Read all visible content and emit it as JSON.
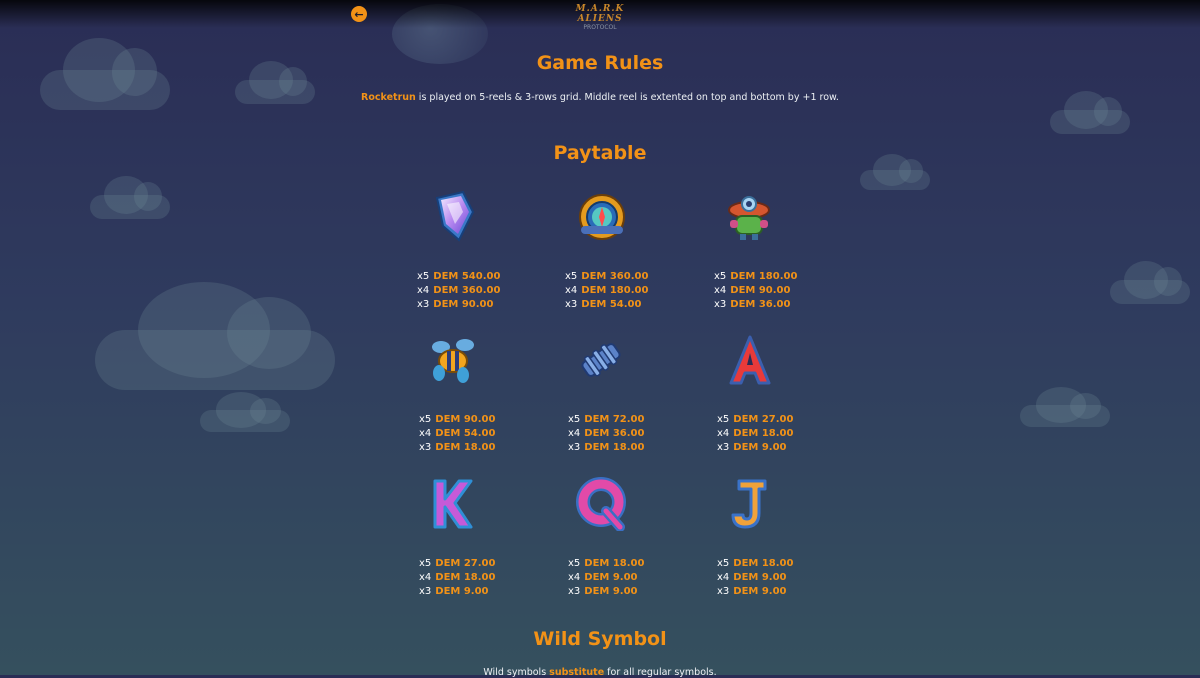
{
  "header": {
    "back_icon": "arrow-left-icon",
    "logo_title": "M.A.R.K ALIENS",
    "logo_sub": "PROTOCOL"
  },
  "rules": {
    "title": "Game Rules",
    "game_name": "Rocketrun",
    "description": " is played on 5-reels & 3-rows grid. Middle reel is extented on top and bottom by +1 row."
  },
  "paytable": {
    "title": "Paytable",
    "symbols": [
      {
        "icon": "crystal-gem-icon",
        "pays": [
          {
            "m": "x5",
            "v": "DEM 540.00"
          },
          {
            "m": "x4",
            "v": "DEM 360.00"
          },
          {
            "m": "x3",
            "v": "DEM 90.00"
          }
        ]
      },
      {
        "icon": "compass-icon",
        "pays": [
          {
            "m": "x5",
            "v": "DEM 360.00"
          },
          {
            "m": "x4",
            "v": "DEM 180.00"
          },
          {
            "m": "x3",
            "v": "DEM 54.00"
          }
        ]
      },
      {
        "icon": "alien-robot-icon",
        "pays": [
          {
            "m": "x5",
            "v": "DEM 180.00"
          },
          {
            "m": "x4",
            "v": "DEM 90.00"
          },
          {
            "m": "x3",
            "v": "DEM 36.00"
          }
        ]
      },
      {
        "icon": "bee-drone-icon",
        "pays": [
          {
            "m": "x5",
            "v": "DEM 90.00"
          },
          {
            "m": "x4",
            "v": "DEM 54.00"
          },
          {
            "m": "x3",
            "v": "DEM 18.00"
          }
        ]
      },
      {
        "icon": "cannon-barrel-icon",
        "pays": [
          {
            "m": "x5",
            "v": "DEM 72.00"
          },
          {
            "m": "x4",
            "v": "DEM 36.00"
          },
          {
            "m": "x3",
            "v": "DEM 18.00"
          }
        ]
      },
      {
        "icon": "letter-a-icon",
        "pays": [
          {
            "m": "x5",
            "v": "DEM 27.00"
          },
          {
            "m": "x4",
            "v": "DEM 18.00"
          },
          {
            "m": "x3",
            "v": "DEM 9.00"
          }
        ]
      },
      {
        "icon": "letter-k-icon",
        "pays": [
          {
            "m": "x5",
            "v": "DEM 27.00"
          },
          {
            "m": "x4",
            "v": "DEM 18.00"
          },
          {
            "m": "x3",
            "v": "DEM 9.00"
          }
        ]
      },
      {
        "icon": "letter-q-icon",
        "pays": [
          {
            "m": "x5",
            "v": "DEM 18.00"
          },
          {
            "m": "x4",
            "v": "DEM 9.00"
          },
          {
            "m": "x3",
            "v": "DEM 9.00"
          }
        ]
      },
      {
        "icon": "letter-j-icon",
        "pays": [
          {
            "m": "x5",
            "v": "DEM 18.00"
          },
          {
            "m": "x4",
            "v": "DEM 9.00"
          },
          {
            "m": "x3",
            "v": "DEM 9.00"
          }
        ]
      }
    ]
  },
  "wild": {
    "title": "Wild Symbol",
    "text_pre": "Wild symbols ",
    "text_accent": "substitute",
    "text_post": " for all regular symbols."
  },
  "colors": {
    "accent": "#f29217",
    "text": "#ffffff",
    "bg_top": "#2a2d55",
    "bg_bottom": "#35505e"
  }
}
